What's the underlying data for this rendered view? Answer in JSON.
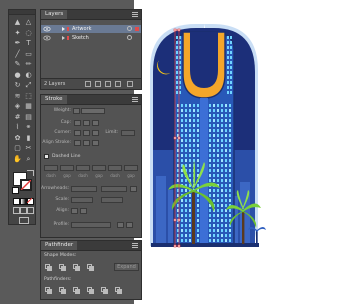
{
  "colors": {
    "ui_background": "#5a5a5a",
    "panel": "#535353",
    "layer_selection": "#6a7a94",
    "artwork_swatch": "#e04b4b",
    "sketch_swatch": "#e04b4b",
    "building_navy": "#1e3b8a",
    "building_blue": "#2f6fd1",
    "window_cyan": "#6fd4ff",
    "arch_orange": "#f4a62a",
    "palm_green": "#7ad13a",
    "moon_yellow": "#f5c518",
    "selection_red": "#e83c3c"
  },
  "layers_panel": {
    "tab": "Layers",
    "rows": [
      {
        "name": "Artwork",
        "selected": true,
        "color": "#e04b4b"
      },
      {
        "name": "Sketch",
        "selected": false,
        "color": "#e04b4b"
      }
    ],
    "count_label": "2 Layers"
  },
  "stroke_panel": {
    "tab": "Stroke",
    "weight_label": "Weight:",
    "cap_label": "Cap:",
    "corner_label": "Corner:",
    "limit_label": "Limit:",
    "align_label": "Align Stroke:",
    "dashed_label": "Dashed Line",
    "dash_labels": [
      "dash",
      "gap",
      "dash",
      "gap",
      "dash",
      "gap"
    ],
    "arrowheads_label": "Arrowheads:",
    "scale_label": "Scale:",
    "align2_label": "Align:",
    "profile_label": "Profile:"
  },
  "pathfinder_panel": {
    "tab": "Pathfinder",
    "shape_modes_label": "Shape Modes:",
    "expand_label": "Expand",
    "pathfinders_label": "Pathfinders:"
  },
  "tools": [
    "selection-tool",
    "direct-selection-tool",
    "magic-wand-tool",
    "lasso-tool",
    "pen-tool",
    "type-tool",
    "line-tool",
    "rectangle-tool",
    "paintbrush-tool",
    "pencil-tool",
    "blob-brush-tool",
    "eraser-tool",
    "rotate-tool",
    "scale-tool",
    "width-tool",
    "free-transform-tool",
    "shape-builder-tool",
    "perspective-grid-tool",
    "mesh-tool",
    "gradient-tool",
    "eyedropper-tool",
    "blend-tool",
    "symbol-sprayer-tool",
    "column-graph-tool",
    "artboard-tool",
    "slice-tool",
    "hand-tool",
    "zoom-tool"
  ]
}
